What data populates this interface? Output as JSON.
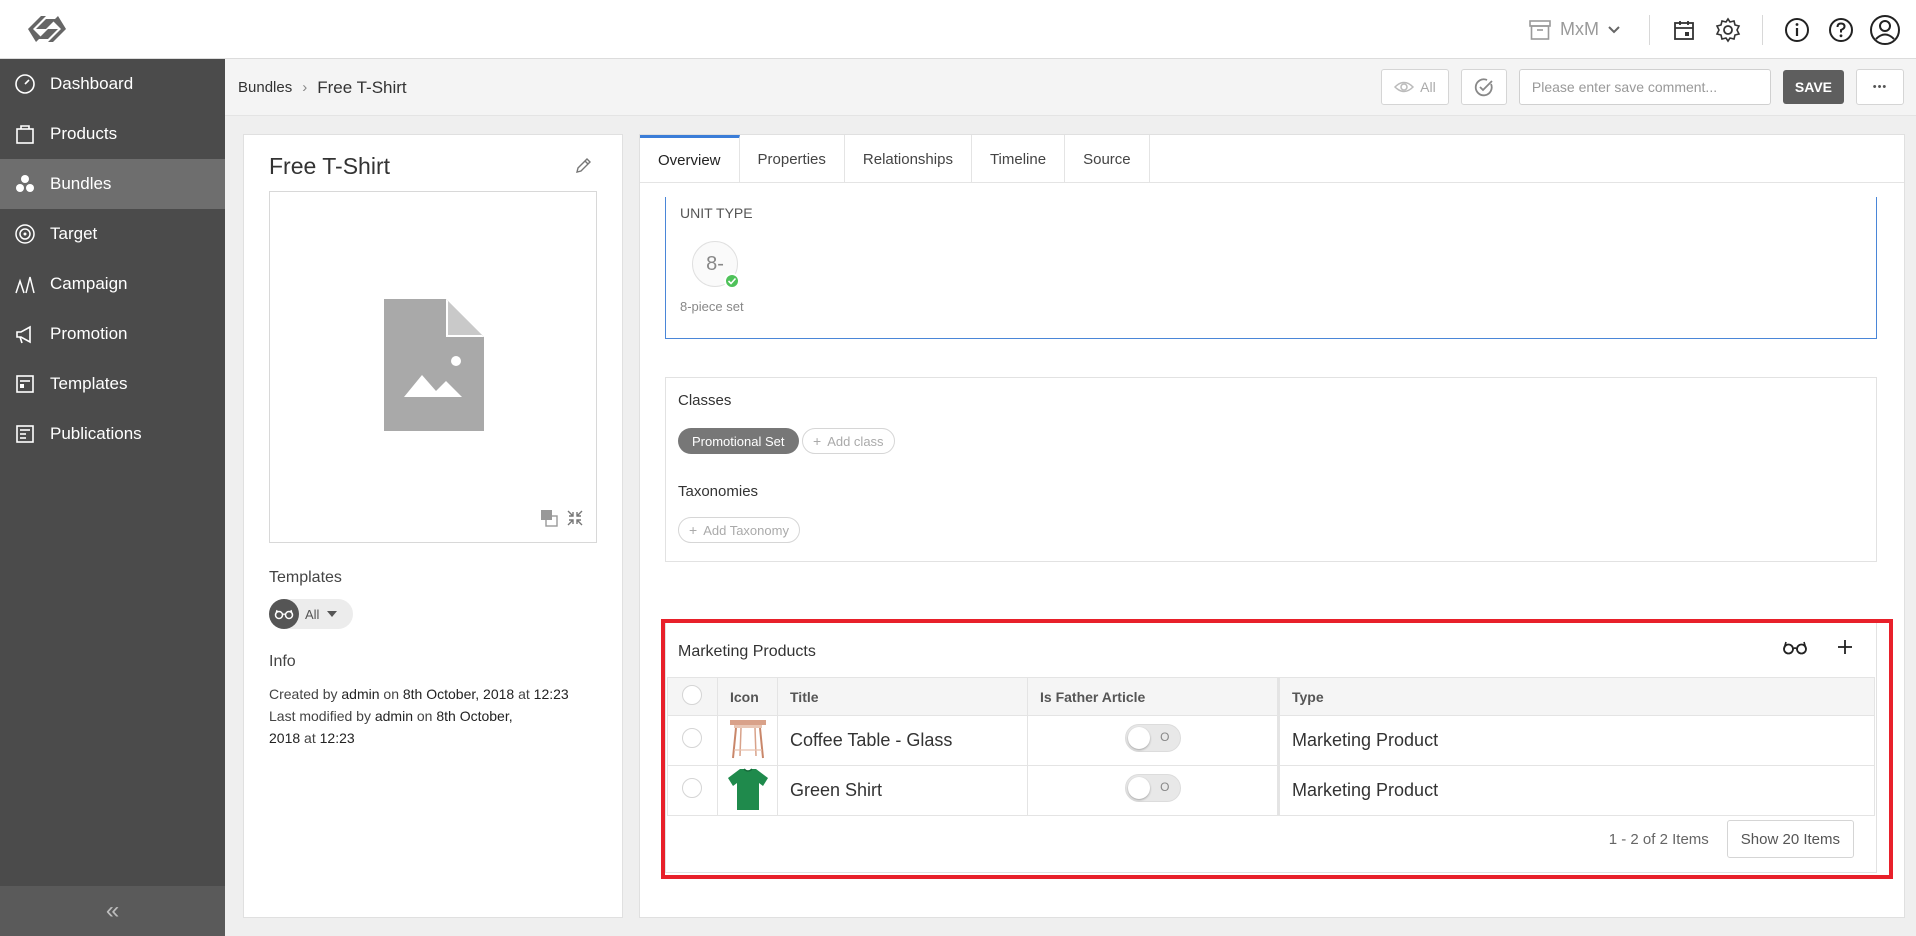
{
  "topbar": {
    "logo_icon": "app-logo-icon",
    "archive_label": "MxM",
    "icons": [
      "calendar-icon",
      "gear-icon",
      "info-icon",
      "help-icon",
      "user-icon"
    ]
  },
  "sidebar": {
    "items": [
      {
        "label": "Dashboard",
        "icon": "dashboard-icon"
      },
      {
        "label": "Products",
        "icon": "products-icon"
      },
      {
        "label": "Bundles",
        "icon": "bundles-icon",
        "active": true
      },
      {
        "label": "Target",
        "icon": "target-icon"
      },
      {
        "label": "Campaign",
        "icon": "campaign-icon"
      },
      {
        "label": "Promotion",
        "icon": "promotion-icon"
      },
      {
        "label": "Templates",
        "icon": "templates-icon"
      },
      {
        "label": "Publications",
        "icon": "publications-icon"
      }
    ],
    "collapse_glyph": "«"
  },
  "subheader": {
    "breadcrumb_root": "Bundles",
    "breadcrumb_sep": "›",
    "breadcrumb_current": "Free T-Shirt",
    "view_all_label": "All",
    "save_comment_placeholder": "Please enter save comment...",
    "save_label": "SAVE",
    "more_glyph": "•••"
  },
  "left": {
    "title": "Free T-Shirt",
    "templates_label": "Templates",
    "templates_value": "All",
    "info_label": "Info",
    "created_prefix": "Created by",
    "created_user": "admin",
    "created_on": "on",
    "created_date": "8th October, 2018",
    "created_at": "at",
    "created_time": "12:23",
    "modified_prefix": "Last modified by",
    "modified_user": "admin",
    "modified_on": "on",
    "modified_date_1": "8th October,",
    "modified_date_2": "2018",
    "modified_at": "at",
    "modified_time": "12:23"
  },
  "tabs": [
    "Overview",
    "Properties",
    "Relationships",
    "Timeline",
    "Source"
  ],
  "unit_type": {
    "title": "UNIT TYPE",
    "badge": "8-",
    "label": "8-piece set"
  },
  "classes": {
    "classes_label": "Classes",
    "class_chip": "Promotional Set",
    "add_class": "Add class",
    "taxonomies_label": "Taxonomies",
    "add_taxonomy": "Add Taxonomy"
  },
  "marketing": {
    "title": "Marketing Products",
    "columns": [
      "Icon",
      "Title",
      "Is Father Article",
      "Type"
    ],
    "rows": [
      {
        "title": "Coffee Table - Glass",
        "type": "Marketing Product",
        "toggle": "O"
      },
      {
        "title": "Green Shirt",
        "type": "Marketing Product",
        "toggle": "O"
      }
    ],
    "pager_text": "1 - 2 of 2 Items",
    "show_label": "Show 20 Items"
  },
  "colors": {
    "sidebar_bg": "#4b4b4b",
    "sidebar_active": "#6e6e6e",
    "accent": "#3b7dd8",
    "highlight": "#e8202a",
    "shirt": "#1f8a4c"
  }
}
